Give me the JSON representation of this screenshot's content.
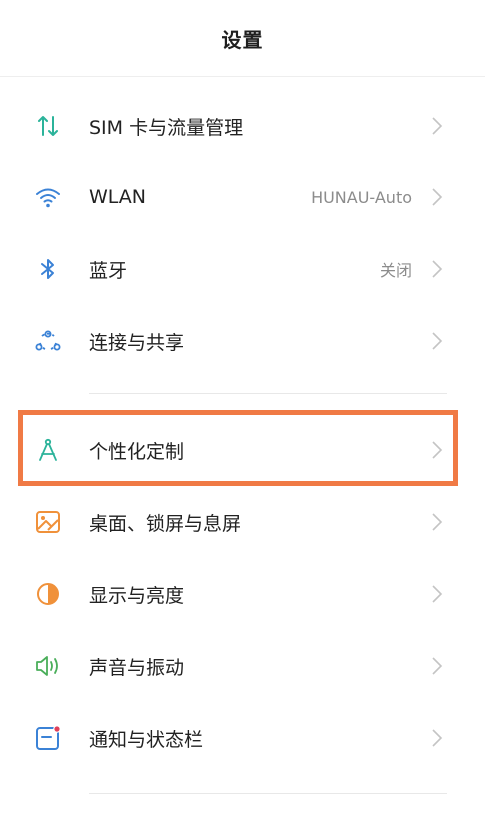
{
  "header": {
    "title": "设置"
  },
  "items": [
    {
      "label": "SIM 卡与流量管理",
      "value": "",
      "icon": "sim-data-icon"
    },
    {
      "label": "WLAN",
      "value": "HUNAU-Auto",
      "icon": "wifi-icon"
    },
    {
      "label": "蓝牙",
      "value": "关闭",
      "icon": "bluetooth-icon"
    },
    {
      "label": "连接与共享",
      "value": "",
      "icon": "connection-share-icon"
    },
    {
      "label": "个性化定制",
      "value": "",
      "icon": "personalization-icon"
    },
    {
      "label": "桌面、锁屏与息屏",
      "value": "",
      "icon": "wallpaper-icon"
    },
    {
      "label": "显示与亮度",
      "value": "",
      "icon": "display-brightness-icon"
    },
    {
      "label": "声音与振动",
      "value": "",
      "icon": "sound-vibration-icon"
    },
    {
      "label": "通知与状态栏",
      "value": "",
      "icon": "notification-statusbar-icon"
    }
  ],
  "colors": {
    "highlight": "#f07a45",
    "teal": "#2bb39a",
    "blue": "#3b82d6",
    "orange": "#f0913a",
    "green": "#4aae5a",
    "pink": "#e0405a"
  }
}
